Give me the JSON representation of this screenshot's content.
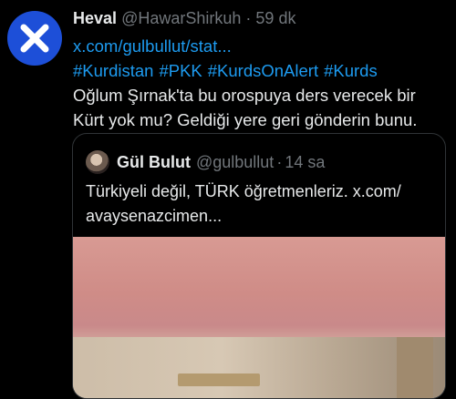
{
  "tweet": {
    "display_name": "Heval",
    "handle": "@HawarShirkuh",
    "dot": "·",
    "time": "59 dk",
    "link": "x.com/gulbullut/stat...",
    "hashtags": [
      "#Kurdistan",
      "#PKK",
      "#KurdsOnAlert",
      "#Kurds"
    ],
    "text_line1": "Oğlum Şırnak'ta bu orospuya ders verecek bir",
    "text_line2": "Kürt yok mu? Geldiği yere geri gönderin bunu.",
    "avatar_icon": "x-mark-icon",
    "avatar_color": "#1d4fd8"
  },
  "quoted": {
    "display_name": "Gül Bulut",
    "handle": "@gulbullut",
    "dot": "·",
    "time": "14 sa",
    "text_line1": "Türkiyeli değil, TÜRK öğretmenleriz. x.com/",
    "text_line2": "avaysenazcimen..."
  },
  "colors": {
    "background": "#000000",
    "text": "#e7e9ea",
    "muted": "#71767b",
    "link": "#1d9bf0"
  }
}
